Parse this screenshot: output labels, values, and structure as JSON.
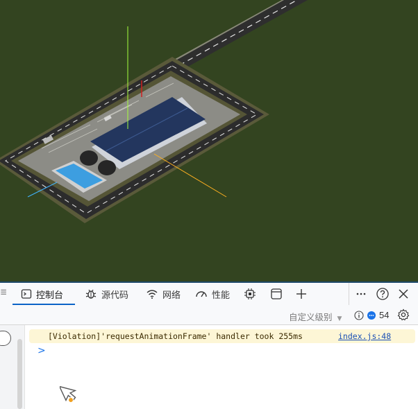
{
  "devtools": {
    "tabs": [
      {
        "label": "控制台",
        "icon": "terminal-icon"
      },
      {
        "label": "源代码",
        "icon": "bug-icon"
      },
      {
        "label": "网络",
        "icon": "wifi-icon"
      },
      {
        "label": "性能",
        "icon": "gauge-icon"
      }
    ],
    "level_filter": "自定义级别",
    "issues_count": "54"
  },
  "console": {
    "message": "[Violation]'requestAnimationFrame' handler took 255ms",
    "source_link": "index.js:48",
    "prompt": ">"
  },
  "colors": {
    "ground": "#334420",
    "accent": "#0b63c7",
    "warning_bg": "#fdf6d6"
  }
}
